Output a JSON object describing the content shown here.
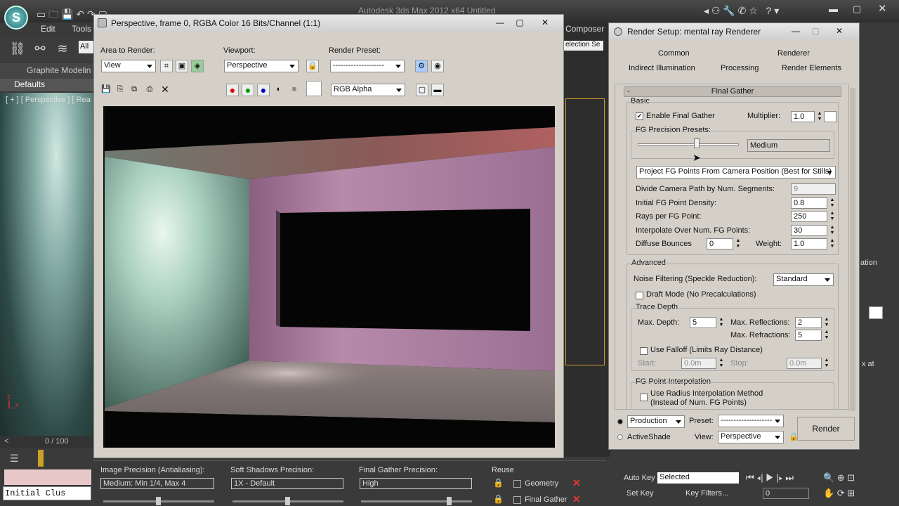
{
  "app": {
    "title": "Autodesk 3ds Max  2012 x64      Untitled",
    "menu": [
      "Edit",
      "Tools"
    ],
    "ribbon_label": "Graphite Modelin",
    "defaults_label": "Defaults",
    "viewport_label": "[ + ] [ Perspective ] [ Rea",
    "timeline": "0 / 100",
    "initial_cluster": "Initial Clus",
    "composer": "Composer",
    "selection_set": "election Se",
    "bottom_right": {
      "auto_key": "Auto Key",
      "set_key": "Set Key",
      "selected": "Selected",
      "key_filters": "Key Filters...",
      "frame": "0"
    }
  },
  "frame_window": {
    "title": "Perspective, frame 0, RGBA Color 16 Bits/Channel (1:1)",
    "area_to_render_label": "Area to Render:",
    "area_to_render_value": "View",
    "viewport_label": "Viewport:",
    "viewport_value": "Perspective",
    "render_preset_label": "Render Preset:",
    "render_preset_value": "--------------------",
    "channel_value": "RGB Alpha"
  },
  "render_setup": {
    "title": "Render Setup: mental ray Renderer",
    "tabs_row1": [
      "Common",
      "Renderer"
    ],
    "tabs_row2": [
      "Indirect Illumination",
      "Processing",
      "Render Elements"
    ],
    "rollout_title": "Final Gather",
    "rollout_toggle": "-",
    "basic": {
      "label": "Basic",
      "enable_fg": "Enable Final Gather",
      "enable_fg_checked": "✔",
      "multiplier_label": "Multiplier:",
      "multiplier_value": "1.0",
      "presets_label": "FG Precision Presets:",
      "preset_value": "Medium",
      "preset_level": 0.58,
      "project_mode": "Project FG Points From Camera Position (Best for Stills)",
      "divide_label": "Divide Camera Path by Num. Segments:",
      "divide_value": "9",
      "density_label": "Initial FG Point Density:",
      "density_value": "0.8",
      "rays_label": "Rays per FG Point:",
      "rays_value": "250",
      "interpolate_label": "Interpolate Over Num. FG Points:",
      "interpolate_value": "30",
      "bounces_label": "Diffuse Bounces",
      "bounces_value": "0",
      "weight_label": "Weight:",
      "weight_value": "1.0"
    },
    "advanced": {
      "label": "Advanced",
      "noise_label": "Noise Filtering (Speckle Reduction):",
      "noise_value": "Standard",
      "draft_mode": "Draft Mode (No Precalculations)",
      "trace_depth_label": "Trace Depth",
      "max_depth_label": "Max. Depth:",
      "max_depth_value": "5",
      "max_reflections_label": "Max. Reflections:",
      "max_reflections_value": "2",
      "max_refractions_label": "Max. Refractions:",
      "max_refractions_value": "5",
      "use_falloff": "Use Falloff (Limits Ray Distance)",
      "start_label": "Start:",
      "start_value": "0.0m",
      "stop_label": "Stop:",
      "stop_value": "0.0m",
      "interp_group_label": "FG Point Interpolation",
      "use_radius_line1": "Use Radius Interpolation Method",
      "use_radius_line2": "(Instead of Num. FG Points)"
    },
    "footer": {
      "production": "Production",
      "activeshade": "ActiveShade",
      "preset_label": "Preset:",
      "preset_value": "--------------------",
      "view_label": "View:",
      "view_value": "Perspective",
      "render_button": "Render"
    }
  },
  "bottom_toolbar": {
    "image_precision_label": "Image Precision (Antialiasing):",
    "image_precision_value": "Medium: Min 1/4, Max 4",
    "image_precision_level": 0.5,
    "soft_shadows_label": "Soft Shadows Precision:",
    "soft_shadows_value": "1X - Default",
    "soft_shadows_level": 0.5,
    "fg_precision_label": "Final Gather Precision:",
    "fg_precision_value": "High",
    "fg_precision_level": 0.8,
    "reuse_label": "Reuse",
    "geometry_label": "Geometry",
    "final_gather_label": "Final Gather"
  },
  "colors": {
    "accent": "#1d6a70",
    "window_bg": "#d4d0c8",
    "app_bg": "#3a3a3a",
    "close_x": "#e33333"
  }
}
